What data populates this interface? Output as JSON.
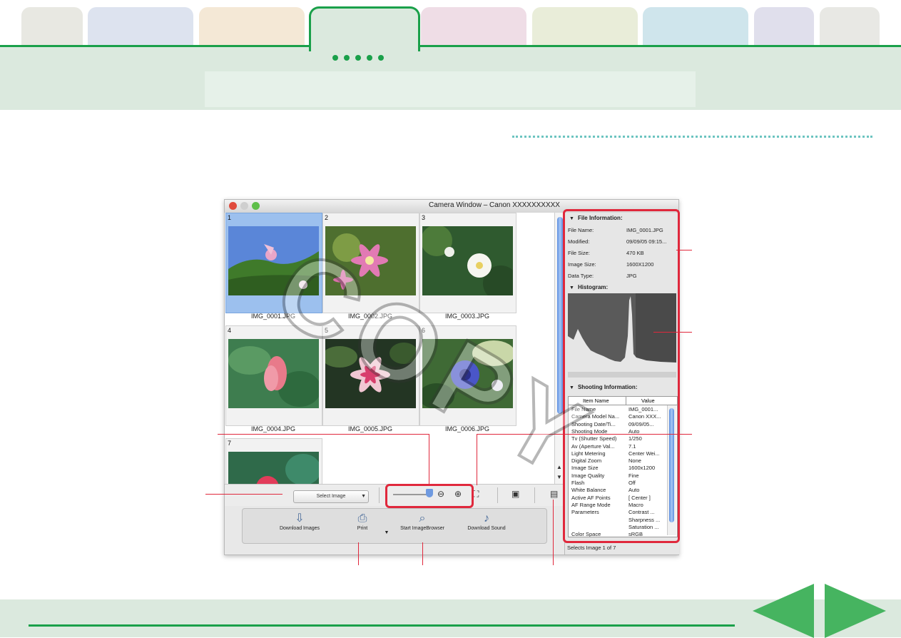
{
  "window": {
    "title": "Camera Window – Canon XXXXXXXXXX"
  },
  "thumbnails": [
    {
      "num": "1",
      "file": "IMG_0001.JPG",
      "selected": true
    },
    {
      "num": "2",
      "file": "IMG_0002.JPG",
      "selected": false
    },
    {
      "num": "3",
      "file": "IMG_0003.JPG",
      "selected": false
    },
    {
      "num": "4",
      "file": "IMG_0004.JPG",
      "selected": false
    },
    {
      "num": "5",
      "file": "IMG_0005.JPG",
      "selected": false
    },
    {
      "num": "6",
      "file": "IMG_0006.JPG",
      "selected": false
    },
    {
      "num": "7",
      "file": "",
      "selected": false
    }
  ],
  "toolbar": {
    "select_image": "Select Image"
  },
  "actions": {
    "download_images": "Download Images",
    "print": "Print",
    "start_browser": "Start ImageBrowser",
    "download_sound": "Download Sound"
  },
  "file_info": {
    "title": "File Information:",
    "rows": [
      {
        "k": "File Name:",
        "v": "IMG_0001.JPG"
      },
      {
        "k": "Modified:",
        "v": "09/09/05 09:15..."
      },
      {
        "k": "File Size:",
        "v": "470 KB"
      },
      {
        "k": "Image Size:",
        "v": "1600X1200"
      },
      {
        "k": "Data Type:",
        "v": "JPG"
      }
    ]
  },
  "histogram": {
    "title": "Histogram:"
  },
  "shooting_info": {
    "title": "Shooting Information:",
    "col_item": "Item Name",
    "col_value": "Value",
    "rows": [
      {
        "k": "File Name",
        "v": "IMG_0001..."
      },
      {
        "k": "Camera Model Na...",
        "v": "Canon XXX..."
      },
      {
        "k": "Shooting Date/Ti...",
        "v": "09/09/05..."
      },
      {
        "k": "Shooting Mode",
        "v": "Auto"
      },
      {
        "k": "Tv (Shutter Speed)",
        "v": "1/250"
      },
      {
        "k": "Av (Aperture Val...",
        "v": "7.1"
      },
      {
        "k": "Light Metering",
        "v": "Center Wei..."
      },
      {
        "k": "Digital Zoom",
        "v": "None"
      },
      {
        "k": "Image Size",
        "v": "1600x1200"
      },
      {
        "k": "Image Quality",
        "v": "Fine"
      },
      {
        "k": "Flash",
        "v": "Off"
      },
      {
        "k": "White Balance",
        "v": "Auto"
      },
      {
        "k": "Active AF Points",
        "v": "[ Center ]"
      },
      {
        "k": "AF Range Mode",
        "v": "Macro"
      },
      {
        "k": "Parameters",
        "v": "Contrast ..."
      },
      {
        "k": "",
        "v": "Sharpness ..."
      },
      {
        "k": "",
        "v": "Saturation ..."
      },
      {
        "k": "Color Space",
        "v": "sRGB"
      }
    ]
  },
  "status": "Selects Image 1 of 7",
  "watermark": "COPY",
  "colors": {
    "accent": "#1aa04a",
    "highlight": "#e0283c",
    "selection": "#9cc0ee"
  }
}
